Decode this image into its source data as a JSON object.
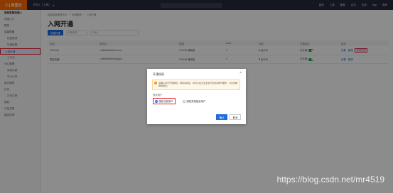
{
  "topbar": {
    "logo": "C-] 阿里云",
    "region": "华东2（上海）",
    "links": [
      "费用",
      "工单",
      "备案",
      "企业",
      "支持",
      "App",
      "简体"
    ]
  },
  "sidebar": {
    "items": [
      {
        "label": "智能客服机器人",
        "type": "header"
      },
      {
        "label": "快速入门",
        "type": "item"
      },
      {
        "label": "概览",
        "type": "item"
      },
      {
        "label": "智能配置",
        "type": "item"
      },
      {
        "label": "机器管理",
        "type": "sub"
      },
      {
        "label": "机器配置",
        "type": "sub"
      },
      {
        "label": "入网开通",
        "type": "active"
      },
      {
        "label": "工作站",
        "type": "sub"
      },
      {
        "label": "中心管理",
        "type": "item"
      },
      {
        "label": "渠道设置",
        "type": "sub"
      },
      {
        "label": "导出记录",
        "type": "sub"
      },
      {
        "label": "统计报表",
        "type": "item"
      },
      {
        "label": "日志",
        "type": "item"
      },
      {
        "label": "异常告警",
        "type": "sub"
      },
      {
        "label": "授权",
        "type": "item"
      },
      {
        "label": "产品文档",
        "type": "item"
      },
      {
        "label": "建议反馈",
        "type": "item"
      }
    ]
  },
  "main": {
    "breadcrumb": [
      "智能客服管理平台",
      "/",
      "机器管理",
      "/",
      "入网开通"
    ],
    "title": "入网开通",
    "create_button": "创建开通",
    "filter_select": "实例名称",
    "search_placeholder": "请输入",
    "columns": [
      "名称",
      "实例ID",
      "",
      "规格",
      "Data",
      "状态",
      "开通状态",
      "操作"
    ],
    "rows": [
      {
        "name": "ATScript",
        "id": "i-uf6bx8x0000xxxxxx",
        "spec": "CS4/16 通用型",
        "data": "1",
        "status": "运行中",
        "open": "已开通",
        "actions": [
          "查看",
          "管理"
        ],
        "highlight": "更改授权"
      },
      {
        "name": "智能机器",
        "id": "i-uf6bx8x0000yyyyyy",
        "spec": "CS4/16 通用型",
        "data": "1",
        "status": "运行中",
        "open": "已开通",
        "actions": [
          "查看",
          "管理"
        ],
        "highlight": ""
      }
    ]
  },
  "dialog": {
    "title": "开通授权",
    "alert": "请确认您已开通授权，授权完成后，将可以在云企业运行您的系统与服务，以及查看授权信息。",
    "label": "授权用户",
    "options": [
      {
        "label": "授权当前用户",
        "selected": true
      },
      {
        "label": "授权其他指定用户",
        "selected": false
      }
    ],
    "confirm": "确认",
    "cancel": "取消"
  },
  "watermark": "https://blog.csdn.net/mr4519"
}
